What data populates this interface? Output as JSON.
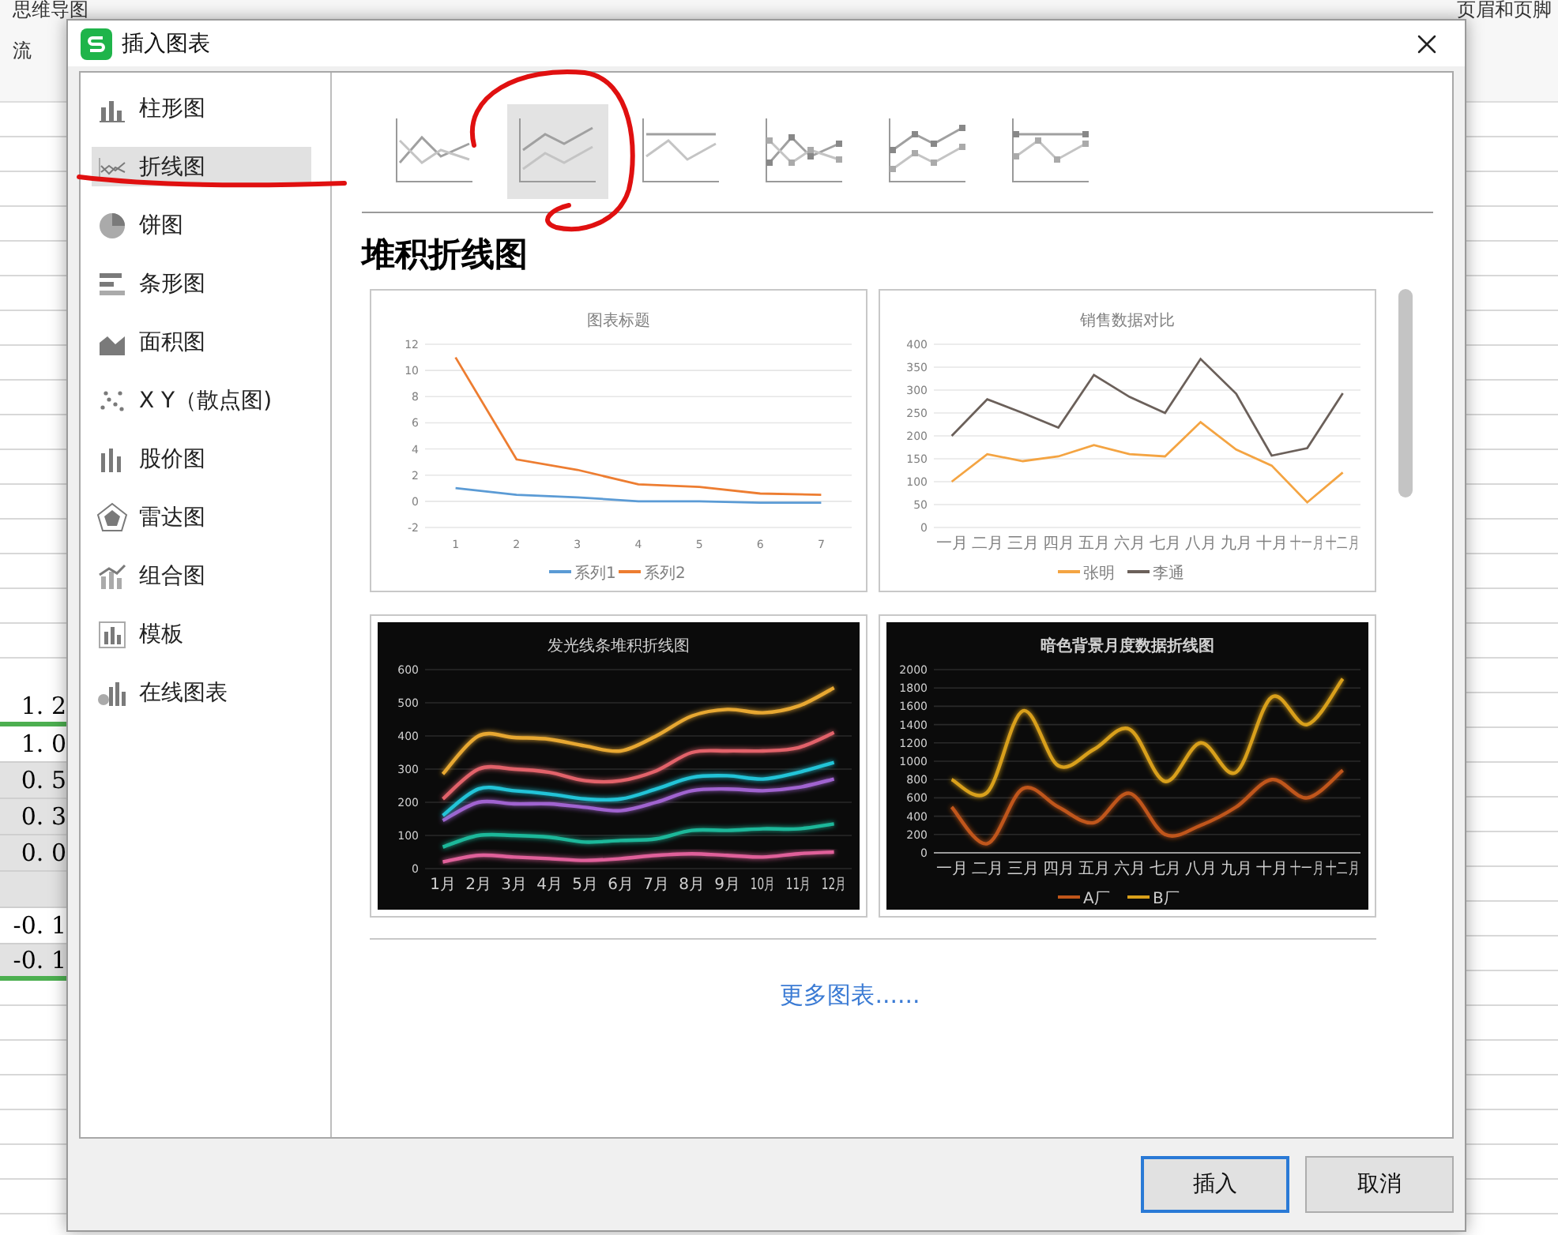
{
  "background": {
    "toolbar": [
      {
        "label": "思维导图"
      },
      {
        "label": "流"
      },
      {
        "label": "页眉和页脚"
      }
    ],
    "cells": [
      {
        "text": "1. 2",
        "shaded": false,
        "rule": true
      },
      {
        "text": "1. 0",
        "shaded": false,
        "rule": false
      },
      {
        "text": "0. 5",
        "shaded": true,
        "rule": false
      },
      {
        "text": "0. 3",
        "shaded": true,
        "rule": false
      },
      {
        "text": "0. 0",
        "shaded": true,
        "rule": false
      },
      {
        "shaded": true,
        "rule": false
      },
      {
        "text": "-0. 1",
        "shaded": false,
        "rule": false
      },
      {
        "text": "-0. 1",
        "shaded": true,
        "rule": true
      }
    ]
  },
  "dialog": {
    "title": "插入图表",
    "sidebar": [
      {
        "label": "柱形图",
        "kind": "bar",
        "selected": false
      },
      {
        "label": "折线图",
        "kind": "line",
        "selected": true
      },
      {
        "label": "饼图",
        "kind": "pie",
        "selected": false
      },
      {
        "label": "条形图",
        "kind": "hbar",
        "selected": false
      },
      {
        "label": "面积图",
        "kind": "area",
        "selected": false
      },
      {
        "label": "X Y（散点图)",
        "kind": "scatter",
        "selected": false
      },
      {
        "label": "股价图",
        "kind": "stock",
        "selected": false
      },
      {
        "label": "雷达图",
        "kind": "radar",
        "selected": false
      },
      {
        "label": "组合图",
        "kind": "combo",
        "selected": false
      },
      {
        "label": "模板",
        "kind": "template",
        "selected": false
      },
      {
        "label": "在线图表",
        "kind": "online",
        "selected": false
      }
    ],
    "subtypes": [
      {
        "kind": "line",
        "selected": false
      },
      {
        "kind": "stacked",
        "selected": true
      },
      {
        "kind": "percent",
        "selected": false
      },
      {
        "kind": "line-markers",
        "selected": false
      },
      {
        "kind": "stacked-markers",
        "selected": false
      },
      {
        "kind": "percent-markers",
        "selected": false
      }
    ],
    "heading": "堆积折线图",
    "previews": [
      {
        "dark": false,
        "chart_data": {
          "type": "line",
          "grid": true,
          "legend": "bottom",
          "title": "图表标题",
          "categories": [
            "1",
            "2",
            "3",
            "4",
            "5",
            "6",
            "7"
          ],
          "ylim": [
            -2,
            12
          ],
          "yticks": [
            -2,
            0,
            2,
            4,
            6,
            8,
            10,
            12
          ],
          "series": [
            {
              "name": "系列1",
              "color": "#5b9bd5",
              "values": [
                1,
                0.5,
                0.3,
                0,
                0,
                -0.1,
                -0.1
              ]
            },
            {
              "name": "系列2",
              "color": "#ed7d31",
              "values": [
                11,
                3.2,
                2.4,
                1.3,
                1.1,
                0.6,
                0.5
              ]
            }
          ]
        }
      },
      {
        "dark": false,
        "chart_data": {
          "type": "line",
          "grid": true,
          "legend": "bottom",
          "title": "销售数据对比",
          "categories": [
            "一月",
            "二月",
            "三月",
            "四月",
            "五月",
            "六月",
            "七月",
            "八月",
            "九月",
            "十月",
            "十一月",
            "十二月"
          ],
          "ylim": [
            0,
            400
          ],
          "yticks": [
            0,
            50,
            100,
            150,
            200,
            250,
            300,
            350,
            400
          ],
          "series": [
            {
              "name": "张明",
              "color": "#f4a442",
              "values": [
                100,
                160,
                145,
                155,
                180,
                160,
                155,
                230,
                170,
                135,
                55,
                120
              ]
            },
            {
              "name": "李通",
              "color": "#6b605a",
              "values": [
                200,
                280,
                250,
                218,
                333,
                285,
                250,
                368,
                292,
                157,
                173,
                293
              ]
            }
          ]
        }
      },
      {
        "dark": true,
        "chart_data": {
          "type": "line",
          "grid": true,
          "title": "发光线条堆积折线图",
          "categories": [
            "1月",
            "2月",
            "3月",
            "4月",
            "5月",
            "6月",
            "7月",
            "8月",
            "9月",
            "10月",
            "11月",
            "12月"
          ],
          "ylim": [
            0,
            600
          ],
          "yticks": [
            0,
            100,
            200,
            300,
            400,
            500,
            600
          ],
          "series": [
            {
              "color": "#e0609a",
              "values": [
                20,
                40,
                35,
                30,
                25,
                30,
                40,
                45,
                40,
                35,
                45,
                50
              ]
            },
            {
              "color": "#1fb89a",
              "values": [
                65,
                100,
                100,
                95,
                80,
                85,
                90,
                115,
                115,
                120,
                120,
                135
              ]
            },
            {
              "color": "#a064d0",
              "values": [
                145,
                200,
                195,
                195,
                185,
                175,
                200,
                235,
                240,
                235,
                245,
                270
              ]
            },
            {
              "color": "#22c4d8",
              "values": [
                160,
                240,
                235,
                225,
                210,
                210,
                240,
                275,
                280,
                270,
                290,
                320
              ]
            },
            {
              "color": "#e2626a",
              "values": [
                210,
                300,
                300,
                290,
                265,
                265,
                295,
                350,
                355,
                355,
                365,
                410
              ]
            },
            {
              "color": "#e8a830",
              "values": [
                285,
                400,
                395,
                390,
                370,
                355,
                400,
                460,
                480,
                470,
                490,
                545
              ]
            }
          ]
        }
      },
      {
        "dark": true,
        "chart_data": {
          "type": "line",
          "grid": true,
          "legend": "bottom",
          "title": "暗色背景月度数据折线图",
          "categories": [
            "一月",
            "二月",
            "三月",
            "四月",
            "五月",
            "六月",
            "七月",
            "八月",
            "九月",
            "十月",
            "十一月",
            "十二月"
          ],
          "ylim": [
            0,
            2000
          ],
          "yticks": [
            0,
            200,
            400,
            600,
            800,
            1000,
            1200,
            1400,
            1600,
            1800,
            2000
          ],
          "series": [
            {
              "name": "A厂",
              "color": "#c0561a",
              "values": [
                500,
                100,
                700,
                500,
                330,
                650,
                200,
                300,
                500,
                800,
                600,
                900
              ]
            },
            {
              "name": "B厂",
              "color": "#d9a01a",
              "values": [
                800,
                660,
                1550,
                950,
                1130,
                1350,
                780,
                1200,
                880,
                1700,
                1400,
                1900
              ]
            }
          ]
        }
      }
    ],
    "more_link": "更多图表......",
    "buttons": [
      {
        "label": "插入",
        "default": true
      },
      {
        "label": "取消",
        "default": false
      }
    ]
  }
}
